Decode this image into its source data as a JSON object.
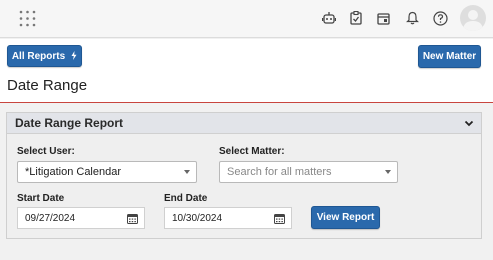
{
  "topbar": {
    "icons": [
      "apps-grid-icon",
      "robot-icon",
      "clipboard-check-icon",
      "calendar-note-icon",
      "bell-icon",
      "help-icon",
      "user-avatar-icon"
    ]
  },
  "header": {
    "all_reports_label": "All Reports",
    "new_matter_label": "New Matter",
    "page_title": "Date Range"
  },
  "report": {
    "title": "Date Range Report",
    "select_user_label": "Select User:",
    "select_user_value": "*Litigation Calendar",
    "select_matter_label": "Select Matter:",
    "select_matter_placeholder": "Search for all matters",
    "start_date_label": "Start Date",
    "start_date_value": "09/27/2024",
    "end_date_label": "End Date",
    "end_date_value": "10/30/2024",
    "view_report_label": "View Report"
  },
  "colors": {
    "primary": "#2a69ac",
    "accent_line": "#c8453e",
    "background": "#f1f1f1"
  }
}
